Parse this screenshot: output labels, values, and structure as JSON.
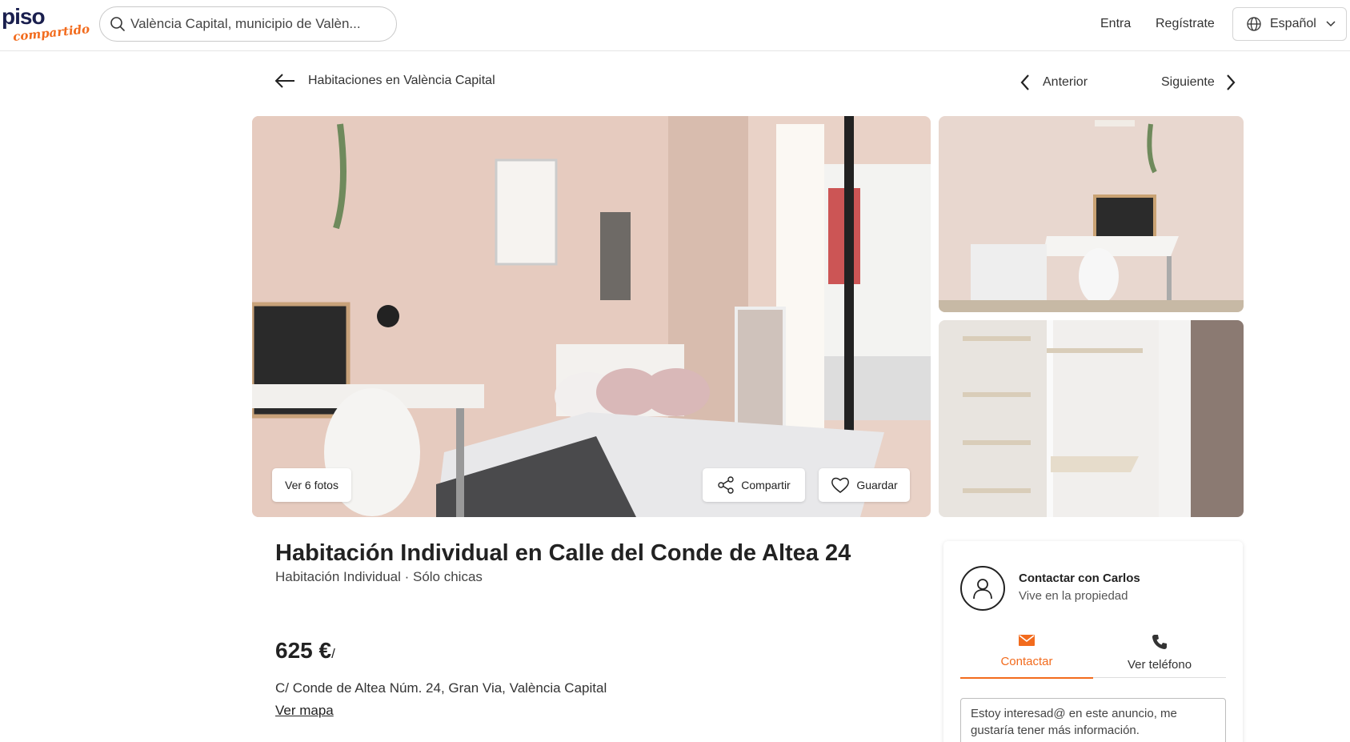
{
  "header": {
    "logo_top": "piso",
    "logo_bottom": "compartido",
    "search_value": "València Capital, municipio de Valèn...",
    "login_label": "Entra",
    "register_label": "Regístrate",
    "language_label": "Español"
  },
  "subnav": {
    "back_label": "Habitaciones en València Capital",
    "prev_label": "Anterior",
    "next_label": "Siguiente"
  },
  "gallery": {
    "see_photos_label": "Ver 6 fotos",
    "share_label": "Compartir",
    "save_label": "Guardar"
  },
  "listing": {
    "title": "Habitación Individual en Calle del Conde de Altea 24",
    "subtitle": "Habitación Individual · Sólo chicas",
    "price": "625 €",
    "price_sep": "/",
    "address": "C/ Conde de Altea Núm. 24, Gran Via, València Capital",
    "map_link": "Ver mapa"
  },
  "contact": {
    "name": "Contactar con Carlos",
    "status": "Vive en la propiedad",
    "tab_contact": "Contactar",
    "tab_phone": "Ver teléfono",
    "message": "Estoy interesad@ en este anuncio, me gustaría tener más información."
  },
  "colors": {
    "brand_orange": "#f26b1d",
    "brand_navy": "#1a1f4e"
  }
}
